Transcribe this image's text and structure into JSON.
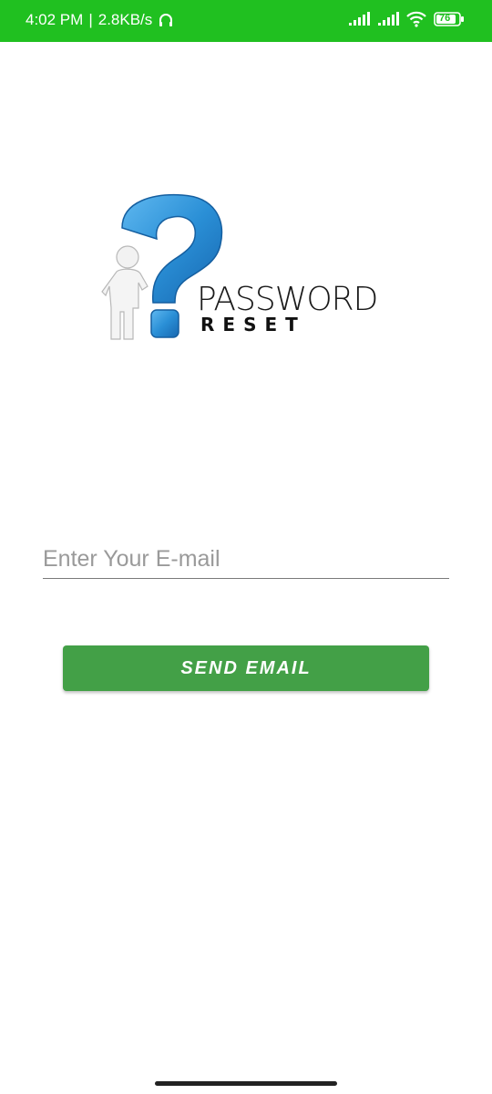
{
  "status_bar": {
    "time": "4:02 PM",
    "separator": "|",
    "speed": "2.8KB/s",
    "battery": "76",
    "icons": [
      "headset-icon",
      "signal-icon",
      "signal-icon",
      "wifi-icon",
      "battery-icon"
    ]
  },
  "logo": {
    "word1": "PASSWORD",
    "word2": "RESET",
    "question_mark_color": "#2a8fd6"
  },
  "form": {
    "email_placeholder": "Enter Your E-mail",
    "email_value": "",
    "send_label": "SEND EMAIL"
  },
  "colors": {
    "status_bar": "#20c020",
    "button": "#43a047"
  }
}
